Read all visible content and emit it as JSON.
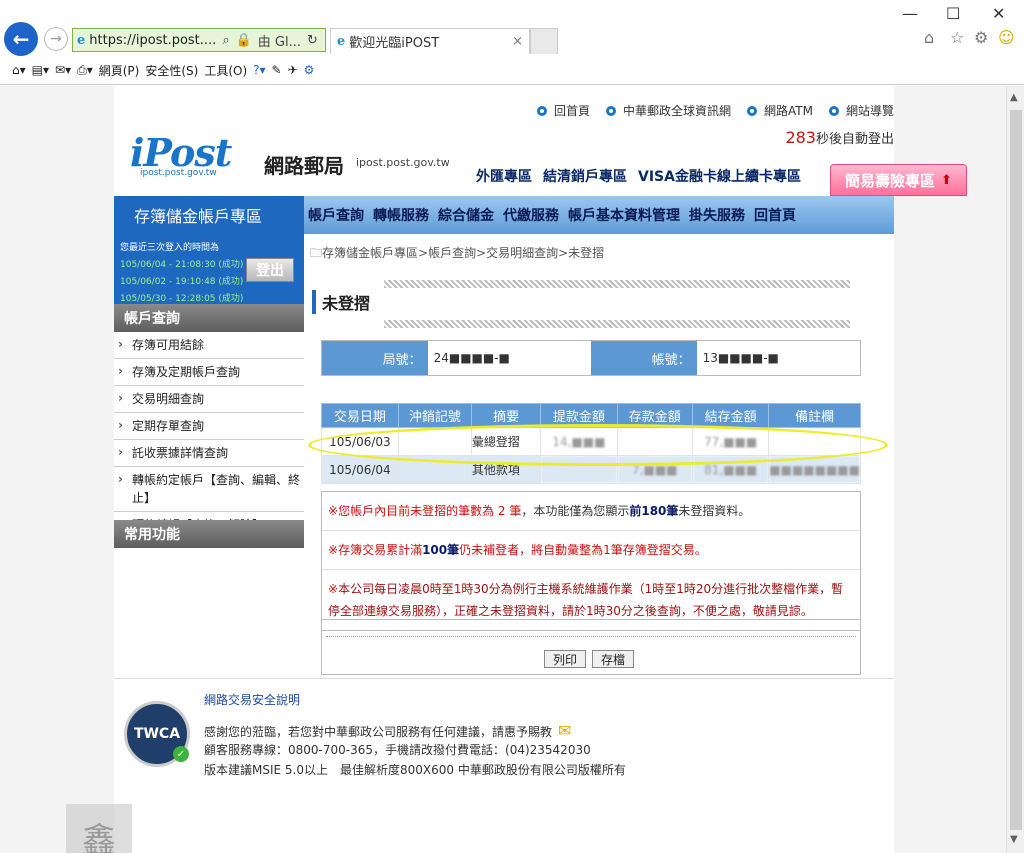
{
  "browser": {
    "url": "https://ipost.post....",
    "site_id": "由 Gl...",
    "tab_title": "歡迎光臨iPOST",
    "tab_close": "×",
    "menu": [
      "網頁(P)",
      "安全性(S)",
      "工具(O)"
    ]
  },
  "header": {
    "logo": "iPost",
    "logo_sub": "ipost.post.gov.tw",
    "site_name": "網路郵局",
    "site_domain": "ipost.post.gov.tw",
    "top_links": [
      "回首頁",
      "中華郵政全球資訊網",
      "網路ATM",
      "網站導覽"
    ],
    "timer_value": "283",
    "timer_text": "秒後自動登出",
    "zones": [
      "外匯專區",
      "結清銷戶專區",
      "VISA金融卡線上續卡專區"
    ],
    "insurance": "簡易壽險專區"
  },
  "nav": {
    "section_title": "存簿儲金帳戶專區",
    "items": [
      "帳戶查詢",
      "轉帳服務",
      "綜合儲金",
      "代繳服務",
      "帳戶基本資料管理",
      "掛失服務",
      "回首頁"
    ]
  },
  "login": {
    "heading": "您最近三次登入的時間為",
    "records": [
      "105/06/04 - 21:08:30 (成功)",
      "105/06/02 - 19:10:48 (成功)",
      "105/05/30 - 12:28:05 (成功)"
    ],
    "logout": "登出"
  },
  "sidebar": {
    "head1": "帳戶查詢",
    "items": [
      "存簿可用結餘",
      "存簿及定期帳戶查詢",
      "交易明細查詢",
      "定期存單查詢",
      "託收票據詳情查詢",
      "轉帳約定帳戶【查詢、編輯、終止】",
      "預約轉帳【查詢、解除】"
    ],
    "head2": "常用功能"
  },
  "main": {
    "breadcrumb": "存簿儲金帳戶專區>帳戶查詢>交易明細查詢>未登摺",
    "title": "未登摺",
    "branch_label": "局號：",
    "branch_value": "24■■■■-■",
    "account_label": "帳號：",
    "account_value": "13■■■■-■",
    "table": {
      "headers": [
        "交易日期",
        "沖銷記號",
        "摘要",
        "提款金額",
        "存款金額",
        "結存金額",
        "備註欄"
      ],
      "rows": [
        {
          "date": "105/06/03",
          "reverse": "",
          "summary": "彙總登摺",
          "withdraw": "14,■■■",
          "deposit": "",
          "balance": "77,■■■",
          "note": ""
        },
        {
          "date": "105/06/04",
          "reverse": "",
          "summary": "其他款項",
          "withdraw": "",
          "deposit": "7,■■■",
          "balance": "81,■■■",
          "note": "■■■■■■■■"
        }
      ]
    },
    "notes": {
      "n1": {
        "mark": "※",
        "a": "您帳戶內目前未登摺的筆數為 2 筆",
        "b": "，本功能僅為您顯示",
        "c": "前180筆",
        "d": "未登摺資料。"
      },
      "n2": {
        "mark": "※",
        "a": "存簿交易累計滿",
        "b": "100筆",
        "c": "仍未補登者，將自動彙整為1筆存簿登摺交易。"
      },
      "n3": {
        "mark": "※",
        "a": "本公司每日凌晨0時至1時30分為例行主機系統維護作業（1時至1時20分進行批次整檔作業，暫停全部連線交易服務），正確之未登摺資料，請於1時30分之後查詢，不便之處，敬請見諒。"
      }
    },
    "print_btn": "列印",
    "save_btn": "存檔"
  },
  "footer": {
    "security_link": "網路交易安全說明",
    "line1": "感謝您的蒞臨，若您對中華郵政公司服務有任何建議，請惠予賜教",
    "line2": "顧客服務專線：0800-700-365，手機請改撥付費電話：(04)23542030",
    "line3": "版本建議MSIE 5.0以上　最佳解析度800X600 中華郵政股份有限公司版權所有",
    "badge": "TWCA"
  },
  "colors": {
    "nav_blue": "#1f68c0",
    "table_header": "#5c98d4",
    "highlight": "#ecec2c",
    "alert_red": "#cc1111"
  }
}
